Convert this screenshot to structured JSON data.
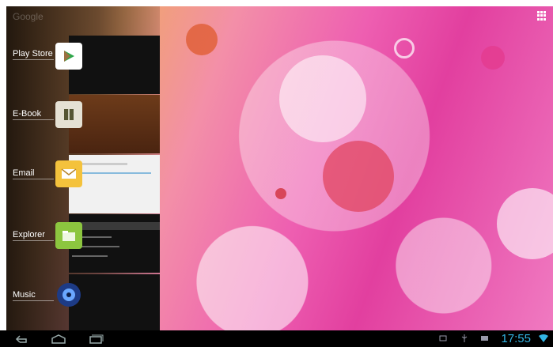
{
  "recents": {
    "faded_header": "Google",
    "apps": [
      {
        "label": "Play Store",
        "icon": "play-store-icon"
      },
      {
        "label": "E-Book",
        "icon": "ebook-icon"
      },
      {
        "label": "Email",
        "icon": "email-icon"
      },
      {
        "label": "Explorer",
        "icon": "explorer-icon"
      },
      {
        "label": "Music",
        "icon": "music-icon"
      }
    ]
  },
  "status": {
    "time": "17:55"
  },
  "colors": {
    "clock": "#33b5e5",
    "navbar": "#000000"
  }
}
